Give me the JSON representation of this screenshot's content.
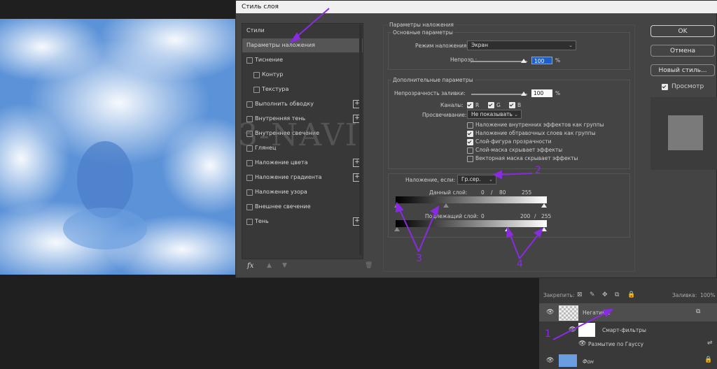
{
  "dialog": {
    "title": "Стиль слоя",
    "styles_header": "Стили",
    "style_items": [
      {
        "label": "Параметры наложения",
        "checkbox": false,
        "plus": false,
        "selected": true
      },
      {
        "label": "Тиснение",
        "checkbox": true,
        "plus": false
      },
      {
        "label": "Контур",
        "checkbox": true,
        "plus": false,
        "indent": true
      },
      {
        "label": "Текстура",
        "checkbox": true,
        "plus": false,
        "indent": true
      },
      {
        "label": "Выполнить обводку",
        "checkbox": true,
        "plus": true
      },
      {
        "label": "Внутренняя тень",
        "checkbox": true,
        "plus": true
      },
      {
        "label": "Внутреннее свечение",
        "checkbox": true,
        "plus": false
      },
      {
        "label": "Глянец",
        "checkbox": true,
        "plus": false
      },
      {
        "label": "Наложение цвета",
        "checkbox": true,
        "plus": true
      },
      {
        "label": "Наложение градиента",
        "checkbox": true,
        "plus": true
      },
      {
        "label": "Наложение узора",
        "checkbox": true,
        "plus": false
      },
      {
        "label": "Внешнее свечение",
        "checkbox": true,
        "plus": false
      },
      {
        "label": "Тень",
        "checkbox": true,
        "plus": true
      }
    ],
    "fx_label": "fx",
    "blending": {
      "section_title": "Параметры наложения",
      "general_title": "Основные параметры",
      "mode_label": "Режим наложения:",
      "mode_value": "Экран",
      "opacity_label": "Непрозр.:",
      "opacity_value": "100",
      "opacity_fraction": 1.0,
      "percent": "%",
      "advanced_title": "Дополнительные параметры",
      "fill_label": "Непрозрачность заливки:",
      "fill_value": "100",
      "fill_fraction": 1.0,
      "channels_label": "Каналы:",
      "channels": [
        "R",
        "G",
        "B"
      ],
      "knockout_label": "Просвечивание:",
      "knockout_value": "Не показывать",
      "options": [
        {
          "label": "Наложение внутренних эффектов как группы",
          "checked": false
        },
        {
          "label": "Наложение обтравочных слоев как группы",
          "checked": true
        },
        {
          "label": "Слой-фигура прозрачности",
          "checked": true
        },
        {
          "label": "Слой-маска скрывает эффекты",
          "checked": false
        },
        {
          "label": "Векторная маска скрывает эффекты",
          "checked": false
        }
      ],
      "blend_if_label": "Наложение, если:",
      "blend_if_value": "Гр.сер.",
      "this_layer_label": "Данный слой:",
      "this_layer_values": {
        "low": "0",
        "sep": "/",
        "mid": "80",
        "high": "255"
      },
      "underlying_label": "Подлежащий слой:",
      "underlying_values": {
        "low": "0",
        "mid": "200",
        "sep": "/",
        "high": "255"
      }
    },
    "buttons": {
      "ok": "OK",
      "cancel": "Отмена",
      "new_style": "Новый стиль...",
      "preview": "Просмотр"
    }
  },
  "annotations": [
    "1",
    "2",
    "3",
    "4"
  ],
  "watermark": "3-NAVI",
  "layers_panel": {
    "lock_label": "Закрепить:",
    "fill_label": "Заливка:",
    "fill_value": "100%",
    "layers": [
      {
        "name": "Негатив 1"
      },
      {
        "name": "Смарт-фильтры"
      },
      {
        "name": "Размытие по Гауссу"
      },
      {
        "name": "Фон"
      }
    ]
  },
  "colors": {
    "accent_annotation": "#8a2be2",
    "dialog_bg": "#444444"
  }
}
